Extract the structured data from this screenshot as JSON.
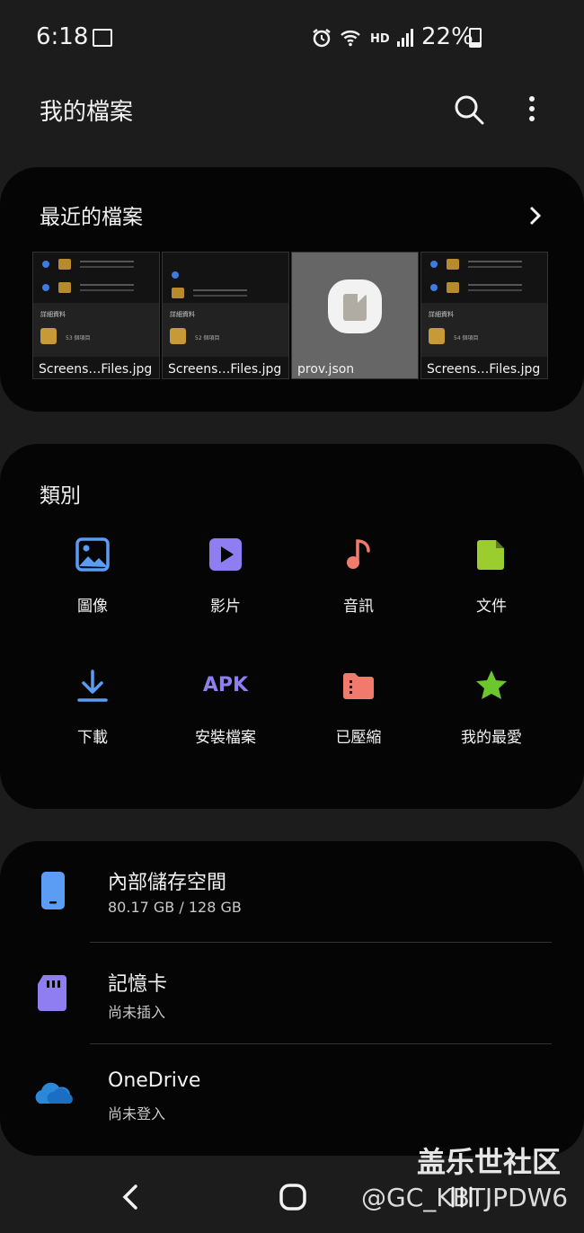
{
  "status": {
    "time": "6:18",
    "network": "HD",
    "battery": "22%",
    "battery_level": 0.22
  },
  "header": {
    "title": "我的檔案",
    "search_icon": "search-icon",
    "more_icon": "more-vert-icon"
  },
  "recent": {
    "title": "最近的檔案",
    "files": [
      {
        "name": "Screens…Files.jpg",
        "panel_count": "53 個項目"
      },
      {
        "name": "Screens…Files.jpg",
        "panel_count": "52 個項目"
      },
      {
        "name": "prov.json"
      },
      {
        "name": "Screens…Files.jpg",
        "panel_count": "54 個項目"
      }
    ]
  },
  "categories": {
    "title": "類別",
    "items": [
      {
        "label": "圖像",
        "icon": "image-icon",
        "color": "#5b9cf5"
      },
      {
        "label": "影片",
        "icon": "video-icon",
        "color": "#8f7df2"
      },
      {
        "label": "音訊",
        "icon": "music-note-icon",
        "color": "#f07b6c"
      },
      {
        "label": "文件",
        "icon": "document-icon",
        "color": "#9ccd2e"
      },
      {
        "label": "下載",
        "icon": "download-icon",
        "color": "#5b9cf5"
      },
      {
        "label": "安裝檔案",
        "icon": "apk-icon",
        "color": "#8f7df2",
        "icon_text": "APK"
      },
      {
        "label": "已壓縮",
        "icon": "compressed-folder-icon",
        "color": "#f07b6c"
      },
      {
        "label": "我的最愛",
        "icon": "star-icon",
        "color": "#6cc72e"
      }
    ]
  },
  "storage": {
    "items": [
      {
        "name": "內部儲存空間",
        "sub": "80.17 GB / 128 GB",
        "icon": "phone-icon",
        "color": "#5b9cf5"
      },
      {
        "name": "記憶卡",
        "sub": "尚未插入",
        "icon": "sd-card-icon",
        "color": "#8f7df2"
      },
      {
        "name": "OneDrive",
        "sub": "尚未登入",
        "icon": "onedrive-icon",
        "color": "#2b88d8"
      }
    ]
  },
  "watermark": {
    "line1": "盖乐世社区",
    "line2": "@GC_KBTJPDW6"
  }
}
